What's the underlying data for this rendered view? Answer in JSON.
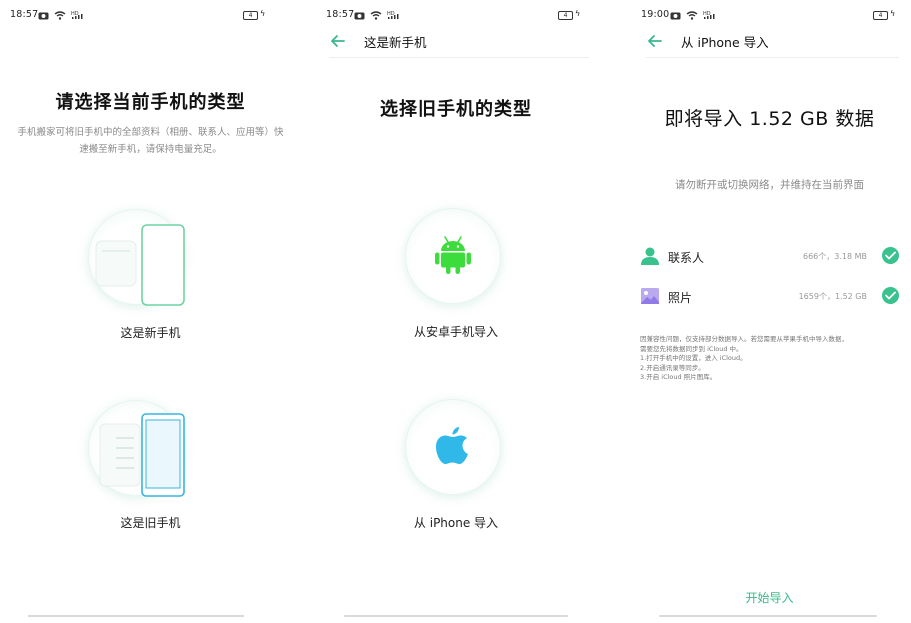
{
  "screen1": {
    "status_time": "18:57",
    "battery_level": "4",
    "title": "请选择当前手机的类型",
    "description": "手机搬家可将旧手机中的全部资料（相册、联系人、应用等）快速搬至新手机，请保持电量充足。",
    "option_new": "这是新手机",
    "option_old": "这是旧手机"
  },
  "screen2": {
    "status_time": "18:57",
    "battery_level": "4",
    "appbar_title": "这是新手机",
    "title": "选择旧手机的类型",
    "option_android": "从安卓手机导入",
    "option_iphone": "从 iPhone 导入"
  },
  "screen3": {
    "status_time": "19:00",
    "battery_level": "4",
    "appbar_title": "从 iPhone 导入",
    "headline": "即将导入 1.52 GB 数据",
    "hint": "请勿断开或切换网络，并维持在当前界面",
    "items": [
      {
        "name": "联系人",
        "meta": "666个，3.18 MB"
      },
      {
        "name": "照片",
        "meta": "1659个，1.52 GB"
      }
    ],
    "notes": [
      "因兼容性问题，仅支持部分数据导入。若您需要从苹果手机中导入数据，",
      "需要您先将数据同步到 iCloud 中。",
      "1.打开手机中的设置，进入 iCloud。",
      "2.开启通讯录等同步。",
      "3.开启 iCloud 照片图库。"
    ],
    "start_button": "开始导入"
  },
  "colors": {
    "accent": "#39b98a",
    "android_green": "#3ddc3d",
    "apple_blue": "#2fb8e8"
  },
  "icons": {
    "back": "back-arrow-icon",
    "camera": "camera-icon",
    "wifi": "wifi-icon",
    "signal": "hd-signal-icon",
    "battery": "battery-icon",
    "android": "android-icon",
    "apple": "apple-icon",
    "contacts": "contacts-icon",
    "photos": "photos-icon",
    "check": "check-icon"
  }
}
